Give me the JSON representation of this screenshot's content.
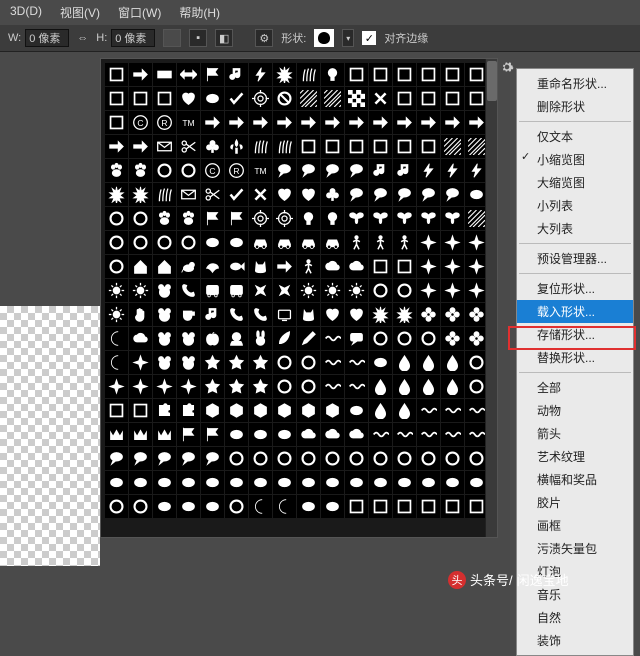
{
  "menubar": [
    "3D(D)",
    "视图(V)",
    "窗口(W)",
    "帮助(H)"
  ],
  "options": {
    "w_label": "W:",
    "w_value": "0 像素",
    "link": "⇔",
    "h_label": "H:",
    "h_value": "0 像素",
    "shape_label": "形状:",
    "align_label": "对齐边缘",
    "align_checked": "✓"
  },
  "shape_rows": [
    [
      "sq",
      "arrR",
      "rect",
      "arrBoth",
      "flag",
      "note",
      "bolt",
      "burst",
      "grass",
      "bulb",
      "sq",
      "sq",
      "sq",
      "sq",
      "sq",
      "sq"
    ],
    [
      "sq",
      "sq",
      "sq",
      "heart",
      "blob",
      "check",
      "target",
      "no",
      "hatch",
      "hatch",
      "checker",
      "x",
      "sq",
      "sq",
      "sq",
      "sq"
    ],
    [
      "sq",
      "circC",
      "circR",
      "tm",
      "arrR",
      "arrR",
      "arrR",
      "arrR",
      "arrR",
      "arrR",
      "arrR",
      "arrR",
      "arrR",
      "arrR",
      "arrR",
      "arrR"
    ],
    [
      "arrR",
      "arrR",
      "mail",
      "scis",
      "club",
      "fleur",
      "grass",
      "grass",
      "sq",
      "sq",
      "sq",
      "sq",
      "sq",
      "sq",
      "hatch",
      "hatch"
    ],
    [
      "paw",
      "paw",
      "ring",
      "ring",
      "circC",
      "circR",
      "tm",
      "bubble",
      "bubble",
      "bubble",
      "bubble",
      "note",
      "note",
      "bolt",
      "bolt",
      "bolt"
    ],
    [
      "burst",
      "burst",
      "grass",
      "mail",
      "scis",
      "check",
      "x",
      "heart",
      "heart",
      "club",
      "bubble",
      "bubble",
      "bubble",
      "bubble",
      "bubble",
      "blob"
    ],
    [
      "ring",
      "ring",
      "paw",
      "paw",
      "flag",
      "flag",
      "target",
      "target",
      "bulb",
      "bulb",
      "fly",
      "fly",
      "fly",
      "fly",
      "fly",
      "hatch"
    ],
    [
      "ring",
      "ring",
      "ring",
      "ring",
      "blob",
      "blob",
      "car",
      "car",
      "car",
      "car",
      "man",
      "man",
      "man",
      "star4",
      "star4",
      "star4"
    ],
    [
      "ring",
      "house",
      "house",
      "dog",
      "bird",
      "fish",
      "cat",
      "arrR",
      "man",
      "cloud",
      "cloud",
      "sq",
      "sq",
      "star4",
      "star4",
      "star4"
    ],
    [
      "sun",
      "sun",
      "bear",
      "phone",
      "bus",
      "bus",
      "plane",
      "plane",
      "sun",
      "sun",
      "sun",
      "ring",
      "ring",
      "star4",
      "star4",
      "star4"
    ],
    [
      "sun",
      "hand",
      "bear",
      "cup",
      "note",
      "phone",
      "phone",
      "tv",
      "cat",
      "heart",
      "heart",
      "burst",
      "burst",
      "flower",
      "flower",
      "flower"
    ],
    [
      "moon",
      "cloud",
      "bear",
      "bear",
      "apple",
      "head",
      "bunny",
      "leaf",
      "pencil",
      "wave",
      "talk",
      "ring",
      "ring",
      "ring",
      "flower",
      "flower"
    ],
    [
      "moon",
      "star4",
      "bear",
      "bear",
      "star",
      "star",
      "star",
      "ring",
      "ring",
      "wave",
      "wave",
      "blob",
      "drop",
      "drop",
      "drop",
      "ring"
    ],
    [
      "star4",
      "star4",
      "star4",
      "star4",
      "star",
      "star",
      "star",
      "ring",
      "ring",
      "wave",
      "wave",
      "drop",
      "drop",
      "drop",
      "drop",
      "ring"
    ],
    [
      "sq",
      "sq",
      "puzzle",
      "puzzle",
      "hex",
      "hex",
      "hex",
      "hex",
      "hex",
      "hex",
      "blob",
      "drop",
      "drop",
      "wave",
      "wave",
      "wave"
    ],
    [
      "crown",
      "crown",
      "crown",
      "flag",
      "flag",
      "blob",
      "blob",
      "blob",
      "cloud",
      "cloud",
      "cloud",
      "wave",
      "wave",
      "wave",
      "wave",
      "wave"
    ],
    [
      "bubble",
      "bubble",
      "bubble",
      "bubble",
      "bubble",
      "ring",
      "ring",
      "ring",
      "ring",
      "ring",
      "ring",
      "ring",
      "ring",
      "ring",
      "ring",
      "ring"
    ],
    [
      "blob",
      "blob",
      "blob",
      "blob",
      "blob",
      "blob",
      "blob",
      "blob",
      "blob",
      "blob",
      "blob",
      "blob",
      "blob",
      "blob",
      "blob",
      "blob"
    ],
    [
      "ring",
      "ring",
      "blob",
      "blob",
      "blob",
      "ring",
      "moon",
      "moon",
      "blob",
      "blob",
      "sq",
      "sq",
      "sq",
      "sq",
      "sq",
      "sq"
    ]
  ],
  "flyout": [
    {
      "t": "i",
      "label": "重命名形状..."
    },
    {
      "t": "i",
      "label": "删除形状"
    },
    {
      "t": "s"
    },
    {
      "t": "i",
      "label": "仅文本"
    },
    {
      "t": "i",
      "label": "小缩览图",
      "check": true
    },
    {
      "t": "i",
      "label": "大缩览图"
    },
    {
      "t": "i",
      "label": "小列表"
    },
    {
      "t": "i",
      "label": "大列表"
    },
    {
      "t": "s"
    },
    {
      "t": "i",
      "label": "预设管理器..."
    },
    {
      "t": "s"
    },
    {
      "t": "i",
      "label": "复位形状..."
    },
    {
      "t": "i",
      "label": "载入形状...",
      "sel": true
    },
    {
      "t": "i",
      "label": "存储形状..."
    },
    {
      "t": "i",
      "label": "替换形状..."
    },
    {
      "t": "s"
    },
    {
      "t": "i",
      "label": "全部"
    },
    {
      "t": "i",
      "label": "动物"
    },
    {
      "t": "i",
      "label": "箭头"
    },
    {
      "t": "i",
      "label": "艺术纹理"
    },
    {
      "t": "i",
      "label": "横幅和奖品"
    },
    {
      "t": "i",
      "label": "胶片"
    },
    {
      "t": "i",
      "label": "画框"
    },
    {
      "t": "i",
      "label": "污渍矢量包"
    },
    {
      "t": "i",
      "label": "灯泡"
    },
    {
      "t": "i",
      "label": "音乐"
    },
    {
      "t": "i",
      "label": "自然"
    },
    {
      "t": "i",
      "label": "装饰"
    }
  ],
  "watermark": {
    "prefix": "头条号/",
    "name": "闲逸宝地"
  }
}
